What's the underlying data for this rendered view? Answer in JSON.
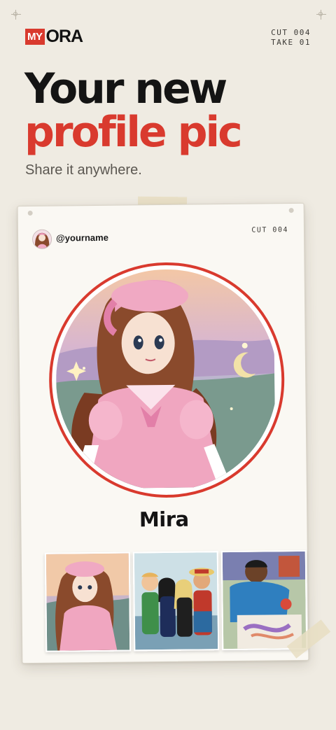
{
  "brand": {
    "logo_my": "MY",
    "logo_ora": "ORA",
    "accent": "#d93a2e"
  },
  "meta": {
    "cut": "CUT 004",
    "take": "TAKE 01"
  },
  "headline": {
    "line1": "Your new",
    "line2": "profile pic"
  },
  "subhead": "Share it anywhere.",
  "card": {
    "username": "@yourname",
    "cut_label": "CUT 004",
    "display_name": "Mira",
    "thumbnails": [
      {
        "name": "anime-girl-pink-dress"
      },
      {
        "name": "anime-group-straw-hat"
      },
      {
        "name": "anime-boy-drawing"
      }
    ]
  },
  "icons": [
    "crosshair-icon",
    "avatar-icon"
  ]
}
